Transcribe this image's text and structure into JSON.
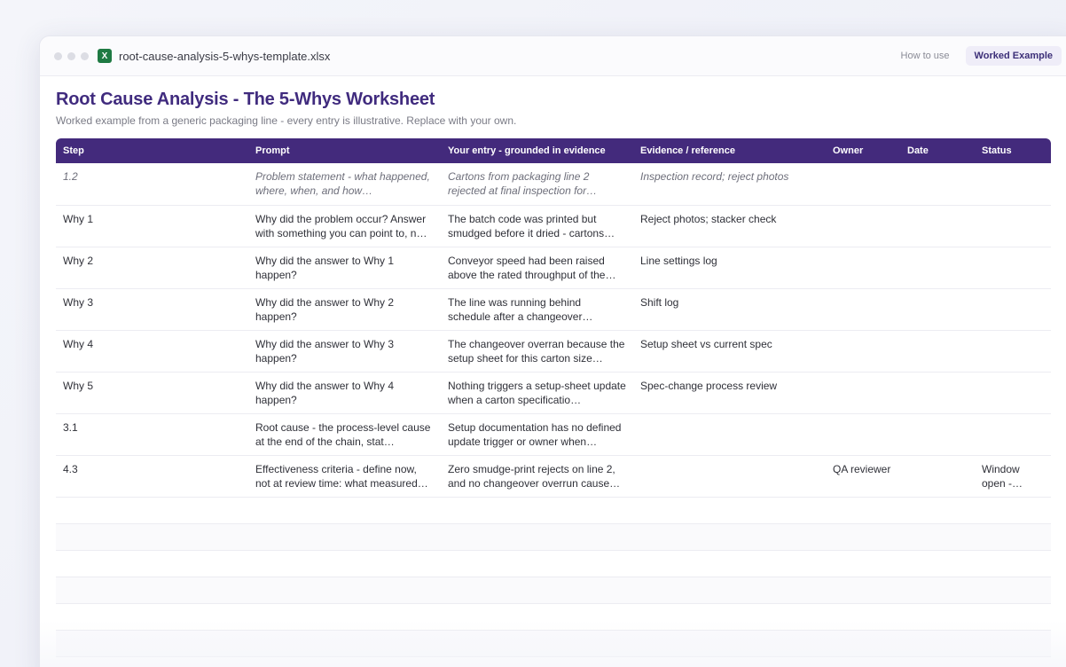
{
  "window": {
    "file_icon_letter": "X",
    "filename": "root-cause-analysis-5-whys-template.xlsx",
    "tabs": [
      {
        "label": "How to use",
        "active": false
      },
      {
        "label": "Worked Example",
        "active": true
      }
    ]
  },
  "sheet": {
    "title": "Root Cause Analysis - The 5-Whys Worksheet",
    "subtitle": "Worked example from a generic packaging line - every entry is illustrative. Replace with your own.",
    "columns": [
      "Step",
      "Prompt",
      "Your entry - grounded in evidence",
      "Evidence / reference",
      "Owner",
      "Date",
      "Status"
    ],
    "rows": [
      {
        "step": "1.2",
        "prompt": "Problem statement - what happened, where, when, and how…",
        "entry": "Cartons from packaging line 2 rejected at final inspection for…",
        "evidence": "Inspection record; reject photos",
        "owner": "",
        "date": "",
        "status": ""
      },
      {
        "step": "Why 1",
        "prompt": "Why did the problem occur? Answer with something you can point to, n…",
        "entry": "The batch code was printed but smudged before it dried - cartons…",
        "evidence": "Reject photos; stacker check",
        "owner": "",
        "date": "",
        "status": ""
      },
      {
        "step": "Why 2",
        "prompt": "Why did the answer to Why 1 happen?",
        "entry": "Conveyor speed had been raised above the rated throughput of the…",
        "evidence": "Line settings log",
        "owner": "",
        "date": "",
        "status": ""
      },
      {
        "step": "Why 3",
        "prompt": "Why did the answer to Why 2 happen?",
        "entry": "The line was running behind schedule after a changeover…",
        "evidence": "Shift log",
        "owner": "",
        "date": "",
        "status": ""
      },
      {
        "step": "Why 4",
        "prompt": "Why did the answer to Why 3 happen?",
        "entry": "The changeover overran because the setup sheet for this carton size…",
        "evidence": "Setup sheet vs current spec",
        "owner": "",
        "date": "",
        "status": ""
      },
      {
        "step": "Why 5",
        "prompt": "Why did the answer to Why 4 happen?",
        "entry": "Nothing triggers a setup-sheet update when a carton specificatio…",
        "evidence": "Spec-change process review",
        "owner": "",
        "date": "",
        "status": ""
      },
      {
        "step": "3.1",
        "prompt": "Root cause - the process-level cause at the end of the chain, stat…",
        "entry": "Setup documentation has no defined update trigger or owner when…",
        "evidence": "",
        "owner": "",
        "date": "",
        "status": ""
      },
      {
        "step": "4.3",
        "prompt": "Effectiveness criteria - define now, not at review time: what measured…",
        "entry": "Zero smudge-print rejects on line 2, and no changeover overrun cause…",
        "evidence": "",
        "owner": "QA reviewer",
        "date": "",
        "status": "Window open -…"
      }
    ]
  }
}
